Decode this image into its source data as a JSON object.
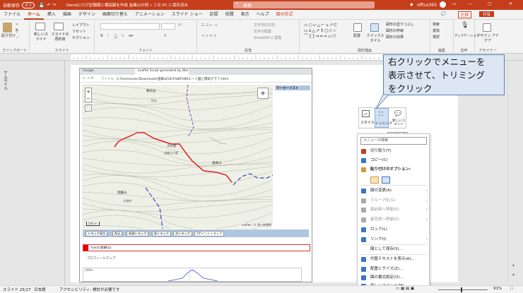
{
  "titlebar": {
    "autosave": "自動保存",
    "autosave_state": "オフ",
    "doc_title": "Owndにログ記録図と標高図を作成  金峰山の例 • この PC に保存済み",
    "search": "検索",
    "account": "office365",
    "brand_color": "#c43e1c"
  },
  "ribbon_tabs": [
    "ファイル",
    "ホーム",
    "挿入",
    "描画",
    "デザイン",
    "画面切り替え",
    "アニメーション",
    "スライド ショー",
    "記録",
    "校閲",
    "表示",
    "ヘルプ",
    "図の形式"
  ],
  "ribbon_right": {
    "record": "記録",
    "share": "共有"
  },
  "ribbon": {
    "paste": "貼り付け",
    "clipboard": "クリップボード",
    "new_slide": "新しいスライド",
    "reuse": "スライドの再利用",
    "layout": "レイアウト",
    "reset": "リセット",
    "section": "セクション",
    "slides": "スライド",
    "font": "フォント",
    "paragraph": "段落",
    "text_dir": "文字列の方向",
    "align_text": "文字の配置",
    "smartart": "SmartArt に変換",
    "drawing": "図形描画",
    "arrange": "配置",
    "quick_styles": "クイックスタイル",
    "fill": "図形の塗りつぶし",
    "outline": "図形の枠線",
    "effects": "図形の効果",
    "find": "検索",
    "replace": "置換",
    "select": "選択",
    "editing": "編集",
    "dictate": "ディクテーション",
    "voice": "音声",
    "designer": "デザイナー",
    "designer2": "デザイン アイデア"
  },
  "browser": {
    "tab1": "Google",
    "tab2": "Leaflet Script generated by Wor",
    "address": "C:/Users/user/Downloads/金峰山%E3%80%80ルート図と標高グラフ.html",
    "file_label": "ファイル",
    "marker_list": "マーカーリスト",
    "map_labels": [
      "朝日岳",
      "金峰山",
      "大日岩",
      "砂払",
      "金峰山小屋",
      "瑞牆山",
      "大弛峠"
    ],
    "scale": "500 m",
    "attribution": "Leaflet | © 国土地理院",
    "toolbar_buttons": [
      "トラック発生",
      "保正",
      "先頭トラック",
      "前トラック",
      "次トラック"
    ],
    "select_value": "5ポイントトラック",
    "track_label": "track(金峰山)",
    "profile_label": "プロフィールマップ",
    "profile_axis": "300m"
  },
  "popup_text": [
    "右クリックでメニューを",
    "表示させて、トリミング",
    "をクリック"
  ],
  "mini_toolbar": {
    "style": "スタイル",
    "trim": "トリミング",
    "new_comment": "新しいコメント",
    "tooltip": "トリミング"
  },
  "context_menu": {
    "search_placeholder": "メニューの検索",
    "items": [
      {
        "label": "切り取り(T)",
        "disabled": false,
        "submenu": false
      },
      {
        "label": "コピー(C)",
        "disabled": false,
        "submenu": false
      },
      {
        "label": "貼り付けのオプション:",
        "disabled": false,
        "submenu": false
      },
      {
        "label": "図の変更(A)",
        "disabled": false,
        "submenu": true
      },
      {
        "label": "グループ化(G)",
        "disabled": true,
        "submenu": true
      },
      {
        "label": "最前面へ移動(R)",
        "disabled": true,
        "submenu": true
      },
      {
        "label": "最背面へ移動(K)",
        "disabled": true,
        "submenu": true
      },
      {
        "label": "ロック(L)",
        "disabled": false,
        "submenu": false
      },
      {
        "label": "リンク(I)",
        "disabled": false,
        "submenu": true
      },
      {
        "label": "図として保存(S)...",
        "disabled": false,
        "submenu": false
      },
      {
        "label": "代替テキストを表示(A)...",
        "disabled": false,
        "submenu": false
      },
      {
        "label": "配置とサイズ(Z)...",
        "disabled": false,
        "submenu": false
      },
      {
        "label": "図の書式設定(O)...",
        "disabled": false,
        "submenu": false
      },
      {
        "label": "新しいコメント(M)",
        "disabled": false,
        "submenu": false
      }
    ]
  },
  "thumbnail_label": "サムネイル",
  "statusbar": {
    "slide": "スライド 25/27",
    "lang": "日本語",
    "accessibility": "アクセシビリティ: 検討が必要です",
    "zoom": "91%"
  }
}
